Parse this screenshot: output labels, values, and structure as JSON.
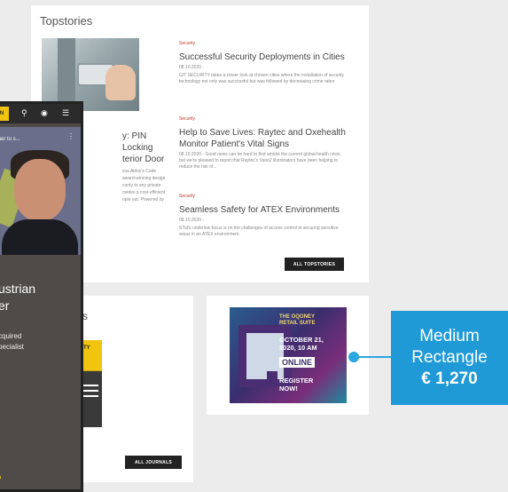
{
  "topstories": {
    "title": "Topstories",
    "stories": [
      {
        "category": "Security",
        "title": "Successful Security Deployments in Cities",
        "date": "08.10.2020 -",
        "excerpt": "GIT SECURITY takes a closer look at chosen cities where the installation of security technology not only was successful but was followed by decreasing crime rates"
      },
      {
        "category": "Security",
        "title": "Help to Save Lives: Raytec and Oxehealth Monitor Patient's Vital Signs",
        "date": "",
        "excerpt": "08.10.2020 - Good news can be hard to find amidst the current global health crisis, but we're pleased to report that Raytec's Vario2 illuminators have been helping to reduce the risk of..."
      },
      {
        "category": "Security",
        "title": "Seamless Safety for ATEX Environments",
        "date": "08.10.2020 -",
        "excerpt": "STid's underlow focus is on the challenges of access control in securing sensitive areas in an ATEX environment."
      }
    ],
    "partial_story": {
      "title_l1": "y: PIN Locking",
      "title_l2": "terior Door",
      "excerpt": "ssa Abloy's Code\n award-winning design\n curity to any private\n ovides a cost-efficient\n ople out. Powered by"
    },
    "button": "ALL TOPSTORIES"
  },
  "journals": {
    "title_fragment": "s",
    "cover_text": "RITY",
    "button": "ALL JOURNALS"
  },
  "ad": {
    "line1": "THE OQONEY",
    "line2": "RETAIL SUITE",
    "date1": "OCTOBER 21,",
    "date2": "2020, 10 AM",
    "online": "ONLINE",
    "register1": "REGISTER",
    "register2": "NOW!"
  },
  "phone": {
    "logo": "N",
    "video_title": "ther to s...",
    "headline_l1": "ustrian",
    "headline_l2": "er",
    "desc_l1": "cquired",
    "desc_l2": "pecialist"
  },
  "callout": {
    "line1": "Medium",
    "line2": "Rectangle",
    "price": "€ 1,270",
    "color": "#1f9ad7"
  }
}
